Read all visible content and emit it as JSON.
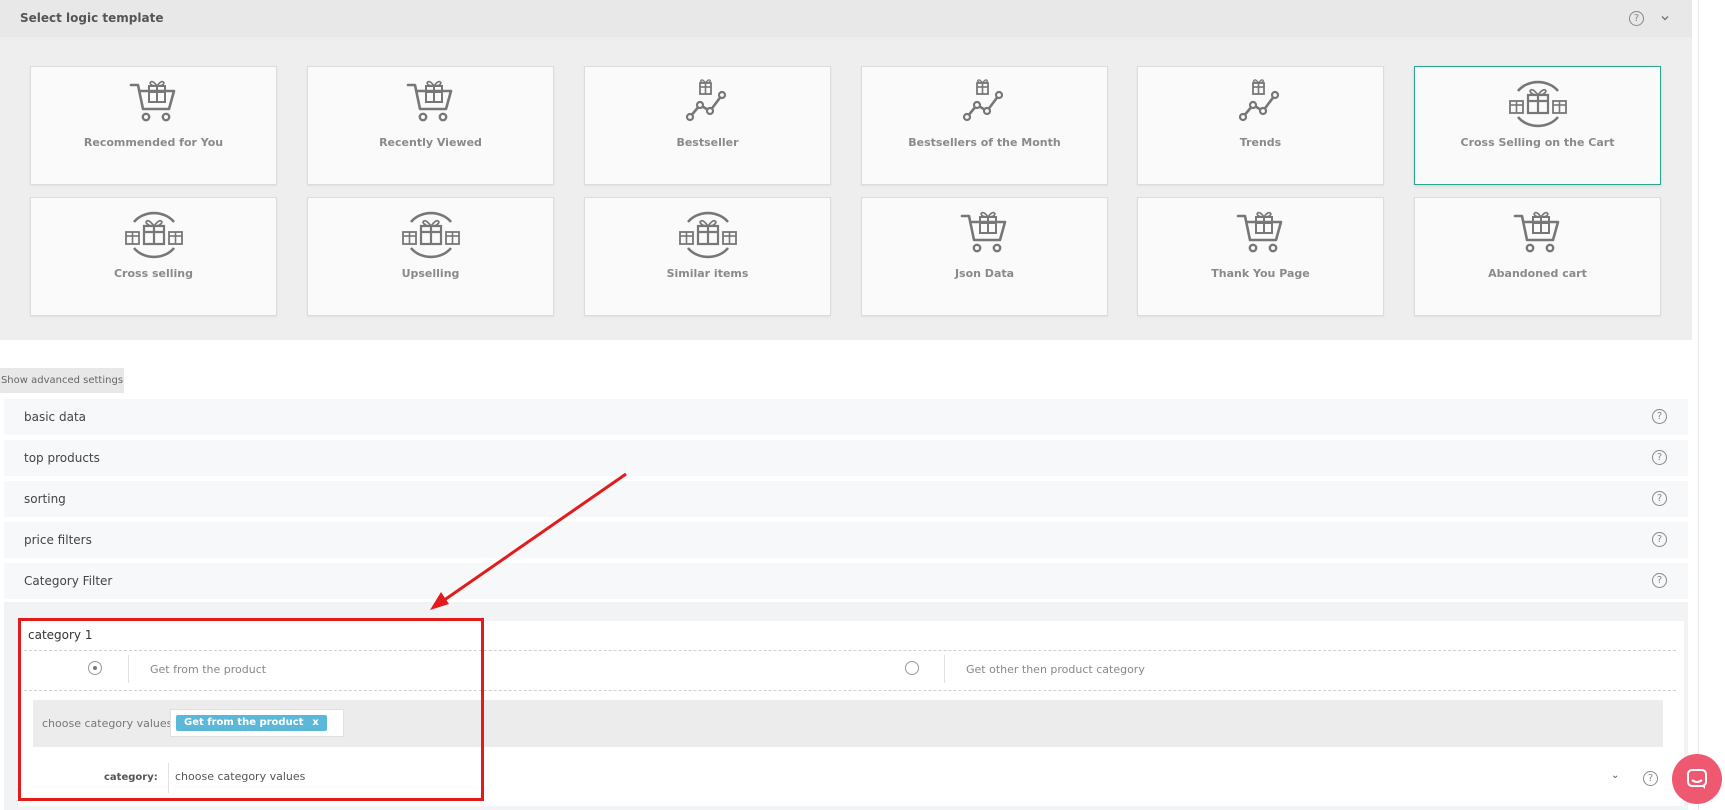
{
  "header": {
    "title": "Select logic template",
    "help_glyph": "?",
    "collapse_glyph": "⌄"
  },
  "templates": [
    {
      "label": "Recommended for You",
      "icon": "cart-gift-icon",
      "selected": false
    },
    {
      "label": "Recently Viewed",
      "icon": "cart-gift-icon",
      "selected": false
    },
    {
      "label": "Bestseller",
      "icon": "trend-gift-icon",
      "selected": false
    },
    {
      "label": "Bestsellers of the Month",
      "icon": "trend-gift-icon",
      "selected": false
    },
    {
      "label": "Trends",
      "icon": "trend-gift-icon",
      "selected": false
    },
    {
      "label": "Cross Selling on the Cart",
      "icon": "gifts-cycle-icon",
      "selected": true
    },
    {
      "label": "Cross selling",
      "icon": "gifts-cycle-icon",
      "selected": false
    },
    {
      "label": "Upselling",
      "icon": "gifts-cycle-icon",
      "selected": false
    },
    {
      "label": "Similar items",
      "icon": "gifts-cycle-icon",
      "selected": false
    },
    {
      "label": "Json Data",
      "icon": "cart-gift-icon",
      "selected": false
    },
    {
      "label": "Thank You Page",
      "icon": "cart-gift-icon",
      "selected": false
    },
    {
      "label": "Abandoned cart",
      "icon": "cart-gift-icon",
      "selected": false
    }
  ],
  "advanced_button": "Show advanced settings",
  "sections": [
    {
      "label": "basic data"
    },
    {
      "label": "top products"
    },
    {
      "label": "sorting"
    },
    {
      "label": "price filters"
    },
    {
      "label": "Category Filter"
    }
  ],
  "category_filter": {
    "title": "category 1",
    "option_product": "Get from the product",
    "option_other": "Get other then product category",
    "selected_option": "Get from the product",
    "values_label": "choose category values",
    "tag": "Get from the product",
    "tag_remove": "x",
    "category_label": "category:",
    "category_select_value": "choose category values",
    "select_chevron": "⌄"
  },
  "colors": {
    "accent": "#2aa58f",
    "annotation": "#e31b1b",
    "tag": "#5bb8d8",
    "chat": "#ee5870"
  }
}
